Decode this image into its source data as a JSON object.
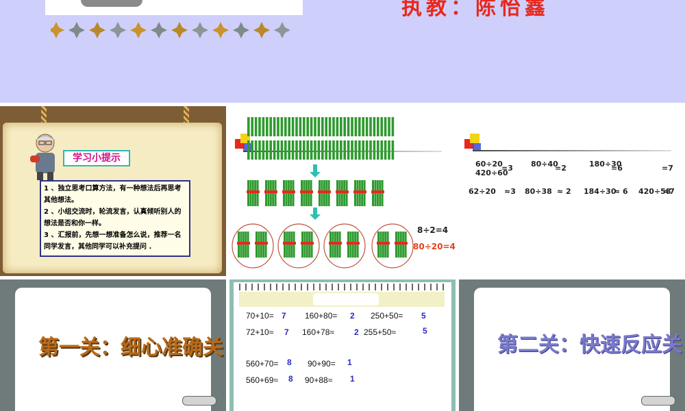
{
  "top_slide": {
    "teacher_text": "执教：陈怡鑫",
    "colors": {
      "background": "#cfcffb",
      "teacher": "#e8281c"
    }
  },
  "slide_tips": {
    "title": "学习小提示",
    "items": [
      "1 、独立思考口算方法，有一种想法后再思考其他想法。",
      "2 、小组交流时，轮流发言，认真倾听别人的想法是否和你一样。",
      "3 、汇报前，先想一想准备怎么说，推荐一名同学发言，其他同学可以补充提问 ."
    ]
  },
  "slide_bundles": {
    "eq1": "8÷2=4",
    "eq2": "80÷20=4",
    "colors": {
      "stick": "#2e9a2e",
      "tie": "#e8281c",
      "arrow": "#2ec0b0",
      "circle": "#c0503a"
    }
  },
  "slide_estimates": {
    "row1": [
      "60÷20",
      "=3",
      "80÷40",
      "=2",
      "180÷30",
      "=6",
      "420÷60",
      "=7"
    ],
    "row2": [
      "62÷20",
      "≈3",
      "80÷38",
      "≈ 2",
      "184÷30",
      "≈ 6",
      "420÷58",
      "≈7"
    ]
  },
  "slide_level1": {
    "title": "第一关：细心准确关",
    "color": "#b86a1a"
  },
  "slide_quiz": {
    "rows": [
      {
        "q": [
          "70+10=",
          "160+80=",
          "250+50="
        ],
        "a": [
          "7",
          "2",
          "5"
        ]
      },
      {
        "q": [
          "72+10≈",
          "160+78≈",
          "255+50≈"
        ],
        "a": [
          "7",
          "2",
          "5"
        ]
      },
      {
        "q": [
          "560+70=",
          "90+90="
        ],
        "a": [
          "8",
          "1"
        ]
      },
      {
        "q": [
          "560+69≈",
          "90+88≈"
        ],
        "a": [
          "8",
          "1"
        ]
      }
    ]
  },
  "slide_level2": {
    "title": "第二关：快速反应关",
    "color": "#7a7acb"
  }
}
